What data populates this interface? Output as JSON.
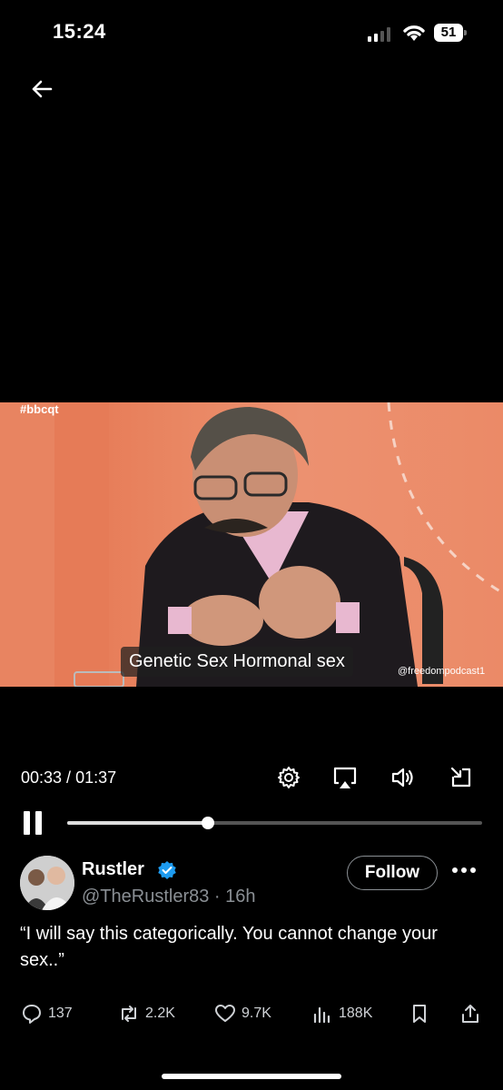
{
  "status_bar": {
    "time": "15:24",
    "battery": "51"
  },
  "video": {
    "hashtag": "#bbcqt",
    "caption": "Genetic Sex Hormonal sex",
    "watermark": "@freedompodcast1",
    "current_time": "00:33",
    "duration": "01:37",
    "time_separator": " / ",
    "progress_fraction": 0.34
  },
  "icons": {
    "back": "arrow-left-icon",
    "settings": "gear-icon",
    "airplay": "airplay-icon",
    "volume": "volume-icon",
    "minimize": "minimize-icon",
    "pause": "pause-icon"
  },
  "tweet": {
    "name": "Rustler",
    "handle_line": "@TheRustler83 · 16h",
    "follow_label": "Follow",
    "text": "“I will say this categorically. You cannot change your sex..”",
    "replies": "137",
    "retweets": "2.2K",
    "likes": "9.7K",
    "views": "188K"
  },
  "colors": {
    "verified": "#1d9bf0",
    "background": "#000000",
    "muted": "#8a8f94"
  }
}
